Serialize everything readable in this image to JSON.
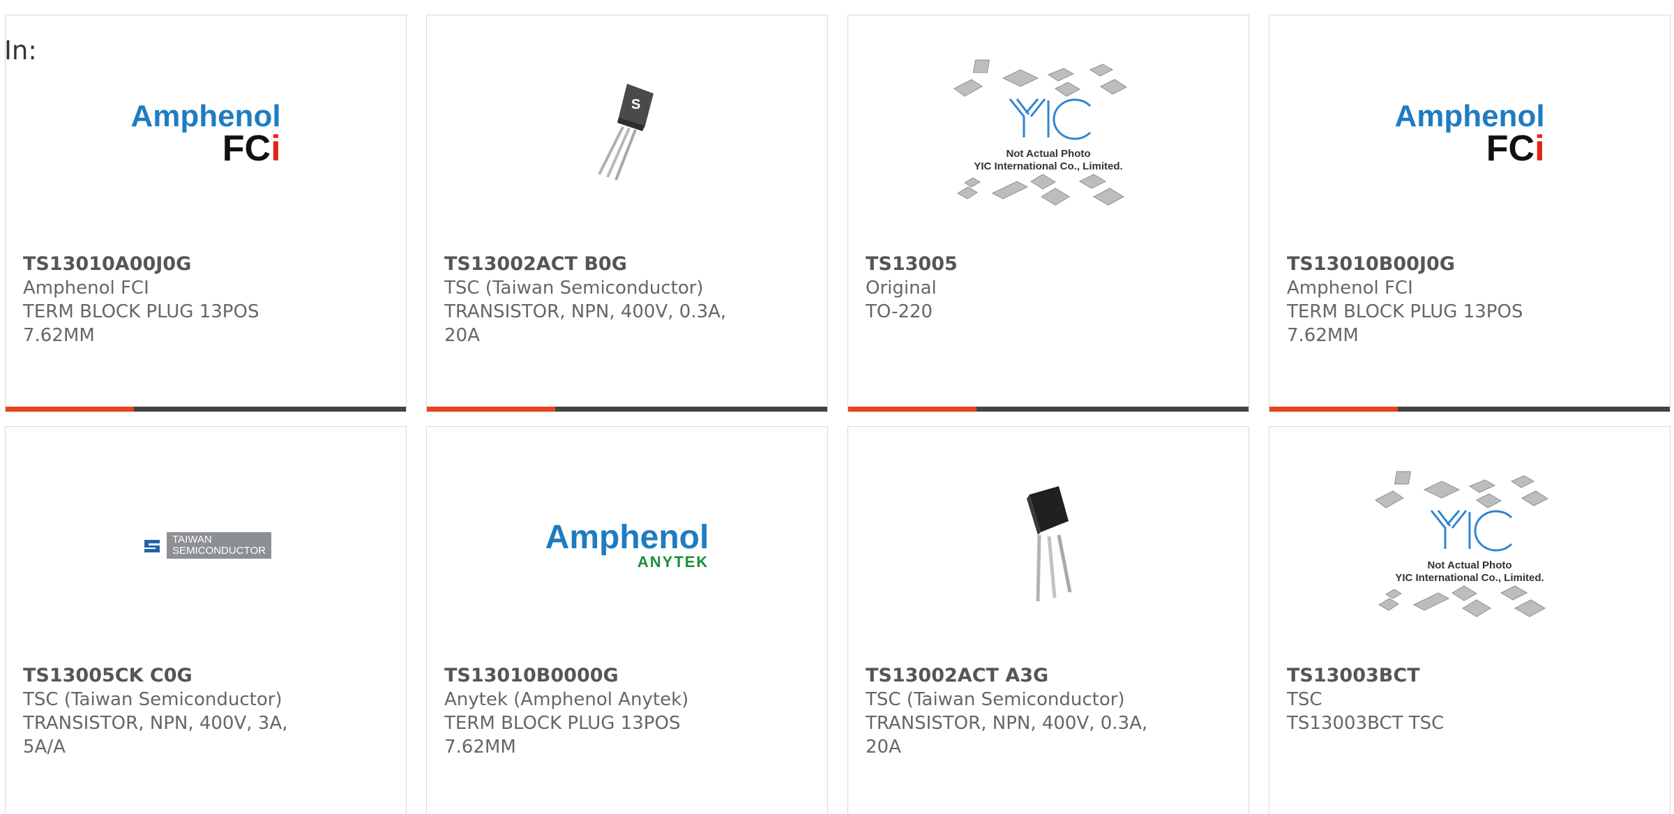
{
  "filter": {
    "label": "In:"
  },
  "products": [
    {
      "part_no": "TS13010A00J0G",
      "manufacturer": "Amphenol FCI",
      "description": "TERM BLOCK PLUG 13POS 7.62MM",
      "image": {
        "type": "brand-logo",
        "brand_line1": "Amphenol",
        "brand_line2_main": "FC",
        "brand_line2_accent": "i"
      },
      "progress": 0.32
    },
    {
      "part_no": "TS13002ACT B0G",
      "manufacturer": "TSC (Taiwan Semiconductor)",
      "description": "TRANSISTOR, NPN, 400V, 0.3A, 20A",
      "image": {
        "type": "to92-photo"
      },
      "progress": 0.32
    },
    {
      "part_no": "TS13005",
      "manufacturer": "Original",
      "description": "TO-220",
      "image": {
        "type": "placeholder",
        "brand": "YIC",
        "note_line1": "Not Actual Photo",
        "note_line2": "YIC International Co., Limited."
      },
      "progress": 0.32
    },
    {
      "part_no": "TS13010B00J0G",
      "manufacturer": "Amphenol FCI",
      "description": "TERM BLOCK PLUG 13POS 7.62MM",
      "image": {
        "type": "brand-logo",
        "brand_line1": "Amphenol",
        "brand_line2_main": "FC",
        "brand_line2_accent": "i"
      },
      "progress": 0.32
    },
    {
      "part_no": "TS13005CK C0G",
      "manufacturer": "TSC (Taiwan Semiconductor)",
      "description": "TRANSISTOR, NPN, 400V, 3A, 5A/A",
      "image": {
        "type": "tsc-logo",
        "line1": "TAIWAN",
        "line2": "SEMICONDUCTOR"
      }
    },
    {
      "part_no": "TS13010B0000G",
      "manufacturer": "Anytek (Amphenol Anytek)",
      "description": "TERM BLOCK PLUG 13POS 7.62MM",
      "image": {
        "type": "anytek-logo",
        "line1": "Amphenol",
        "line2": "ANYTEK"
      }
    },
    {
      "part_no": "TS13002ACT A3G",
      "manufacturer": "TSC (Taiwan Semiconductor)",
      "description": "TRANSISTOR, NPN, 400V, 0.3A, 20A",
      "image": {
        "type": "to92-photo"
      }
    },
    {
      "part_no": "TS13003BCT",
      "manufacturer": "TSC",
      "description": "TS13003BCT TSC",
      "image": {
        "type": "placeholder",
        "brand": "YIC",
        "note_line1": "Not Actual Photo",
        "note_line2": "YIC International Co., Limited."
      }
    }
  ],
  "colors": {
    "progress_fill": "#e8431a",
    "progress_track": "#444444",
    "card_border": "#d9d9d9",
    "amphenol_blue": "#1f7cc1",
    "fci_red": "#e1251b",
    "anytek_green": "#1a8f3a"
  },
  "icons": [
    "chip-placeholder-icon",
    "transistor-to92-icon"
  ]
}
